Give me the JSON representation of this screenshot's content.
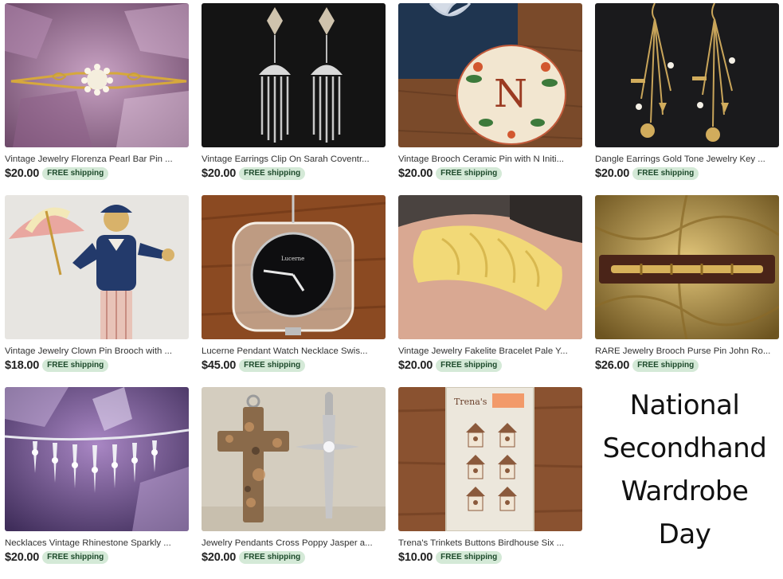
{
  "listings": [
    {
      "title": "Vintage Jewelry Florenza Pearl Bar Pin ...",
      "price": "$20.00",
      "shipping": "FREE shipping",
      "image": "pearl-bar-pin-on-amethyst"
    },
    {
      "title": "Vintage Earrings Clip On Sarah Coventr...",
      "price": "$20.00",
      "shipping": "FREE shipping",
      "image": "tassel-clip-earrings"
    },
    {
      "title": "Vintage Brooch Ceramic Pin with N Initi...",
      "price": "$20.00",
      "shipping": "FREE shipping",
      "image": "ceramic-initial-brooch"
    },
    {
      "title": "Dangle Earrings Gold Tone Jewelry Key ...",
      "price": "$20.00",
      "shipping": "FREE shipping",
      "image": "gold-key-dangle-earrings"
    },
    {
      "title": "Vintage Jewelry Clown Pin Brooch with ...",
      "price": "$18.00",
      "shipping": "FREE shipping",
      "image": "clown-umbrella-brooch"
    },
    {
      "title": "Lucerne Pendant Watch Necklace Swis...",
      "price": "$45.00",
      "shipping": "FREE shipping",
      "image": "lucerne-pendant-watch"
    },
    {
      "title": "Vintage Jewelry Fakelite Bracelet Pale Y...",
      "price": "$20.00",
      "shipping": "FREE shipping",
      "image": "yellow-carved-bangle"
    },
    {
      "title": "RARE Jewelry Brooch Purse Pin John Ro...",
      "price": "$26.00",
      "shipping": "FREE shipping",
      "image": "bamboo-bar-brooch"
    },
    {
      "title": "Necklaces Vintage Rhinestone Sparkly ...",
      "price": "$20.00",
      "shipping": "FREE shipping",
      "image": "rhinestone-necklace"
    },
    {
      "title": "Jewelry Pendants Cross Poppy Jasper a...",
      "price": "$20.00",
      "shipping": "FREE shipping",
      "image": "cross-pendants"
    },
    {
      "title": "Trena's Trinkets Buttons Birdhouse Six ...",
      "price": "$10.00",
      "shipping": "FREE shipping",
      "image": "birdhouse-buttons-card"
    }
  ],
  "promo": {
    "line1": "National",
    "line2": "Secondhand",
    "line3": "Wardrobe",
    "line4": "Day"
  },
  "colors": {
    "shipping_badge_bg": "#d4e9d7",
    "shipping_badge_text": "#1d4a2b"
  }
}
